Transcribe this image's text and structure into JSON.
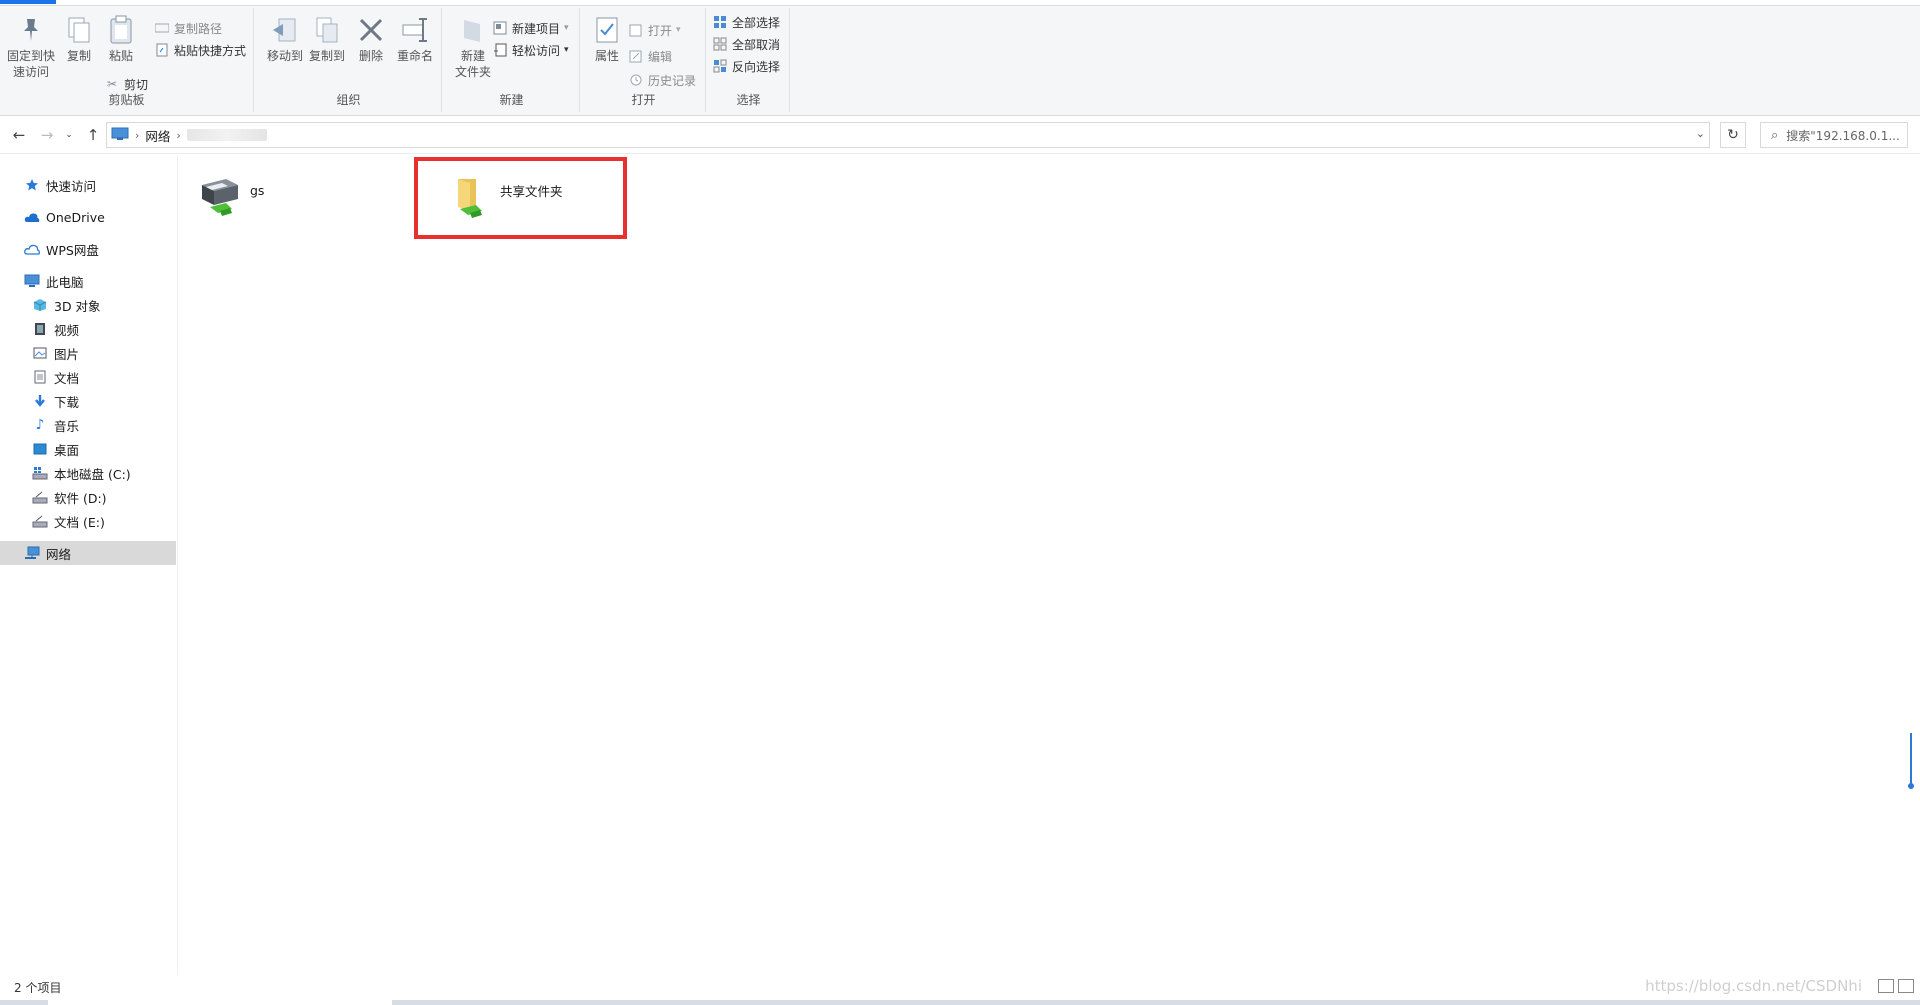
{
  "ribbon": {
    "clipboard": {
      "pin_label": "固定到快\n速访问",
      "copy_label": "复制",
      "paste_label": "粘贴",
      "copy_path_label": "复制路径",
      "paste_shortcut_label": "粘贴快捷方式",
      "cut_label": "剪切",
      "group_label": "剪贴板"
    },
    "organize": {
      "move_to_label": "移动到",
      "copy_to_label": "复制到",
      "delete_label": "删除",
      "rename_label": "重命名",
      "group_label": "组织"
    },
    "new": {
      "new_folder_label": "新建\n文件夹",
      "new_item_label": "新建项目",
      "easy_access_label": "轻松访问",
      "group_label": "新建"
    },
    "open": {
      "properties_label": "属性",
      "open_label": "打开",
      "edit_label": "编辑",
      "history_label": "历史记录",
      "group_label": "打开"
    },
    "select": {
      "select_all_label": "全部选择",
      "select_none_label": "全部取消",
      "invert_label": "反向选择",
      "group_label": "选择"
    }
  },
  "address": {
    "segments": [
      "网络"
    ],
    "search_placeholder": "搜索\"192.168.0.1..."
  },
  "sidebar": {
    "items": [
      {
        "label": "快速访问",
        "icon": "star-icon"
      },
      {
        "label": "OneDrive",
        "icon": "cloud-icon"
      },
      {
        "label": "WPS网盘",
        "icon": "cloud-outline-icon"
      },
      {
        "label": "此电脑",
        "icon": "computer-icon"
      },
      {
        "label": "3D 对象",
        "icon": "cube-icon"
      },
      {
        "label": "视频",
        "icon": "film-icon"
      },
      {
        "label": "图片",
        "icon": "picture-icon"
      },
      {
        "label": "文档",
        "icon": "document-icon"
      },
      {
        "label": "下载",
        "icon": "download-arrow-icon"
      },
      {
        "label": "音乐",
        "icon": "music-note-icon"
      },
      {
        "label": "桌面",
        "icon": "desktop-icon"
      },
      {
        "label": "本地磁盘 (C:)",
        "icon": "drive-icon"
      },
      {
        "label": "软件 (D:)",
        "icon": "drive-icon"
      },
      {
        "label": "文档 (E:)",
        "icon": "drive-icon"
      },
      {
        "label": "网络",
        "icon": "network-icon"
      }
    ]
  },
  "files": [
    {
      "name": "gs",
      "icon": "shared-printer-icon"
    },
    {
      "name": "共享文件夹",
      "icon": "shared-folder-icon"
    }
  ],
  "status": {
    "count_text": "2 个项目",
    "watermark": "https://blog.csdn.net/CSDNhi"
  },
  "colors": {
    "accent": "#1a73e8",
    "highlight": "#e8302f",
    "selection": "#d9d9d9"
  }
}
